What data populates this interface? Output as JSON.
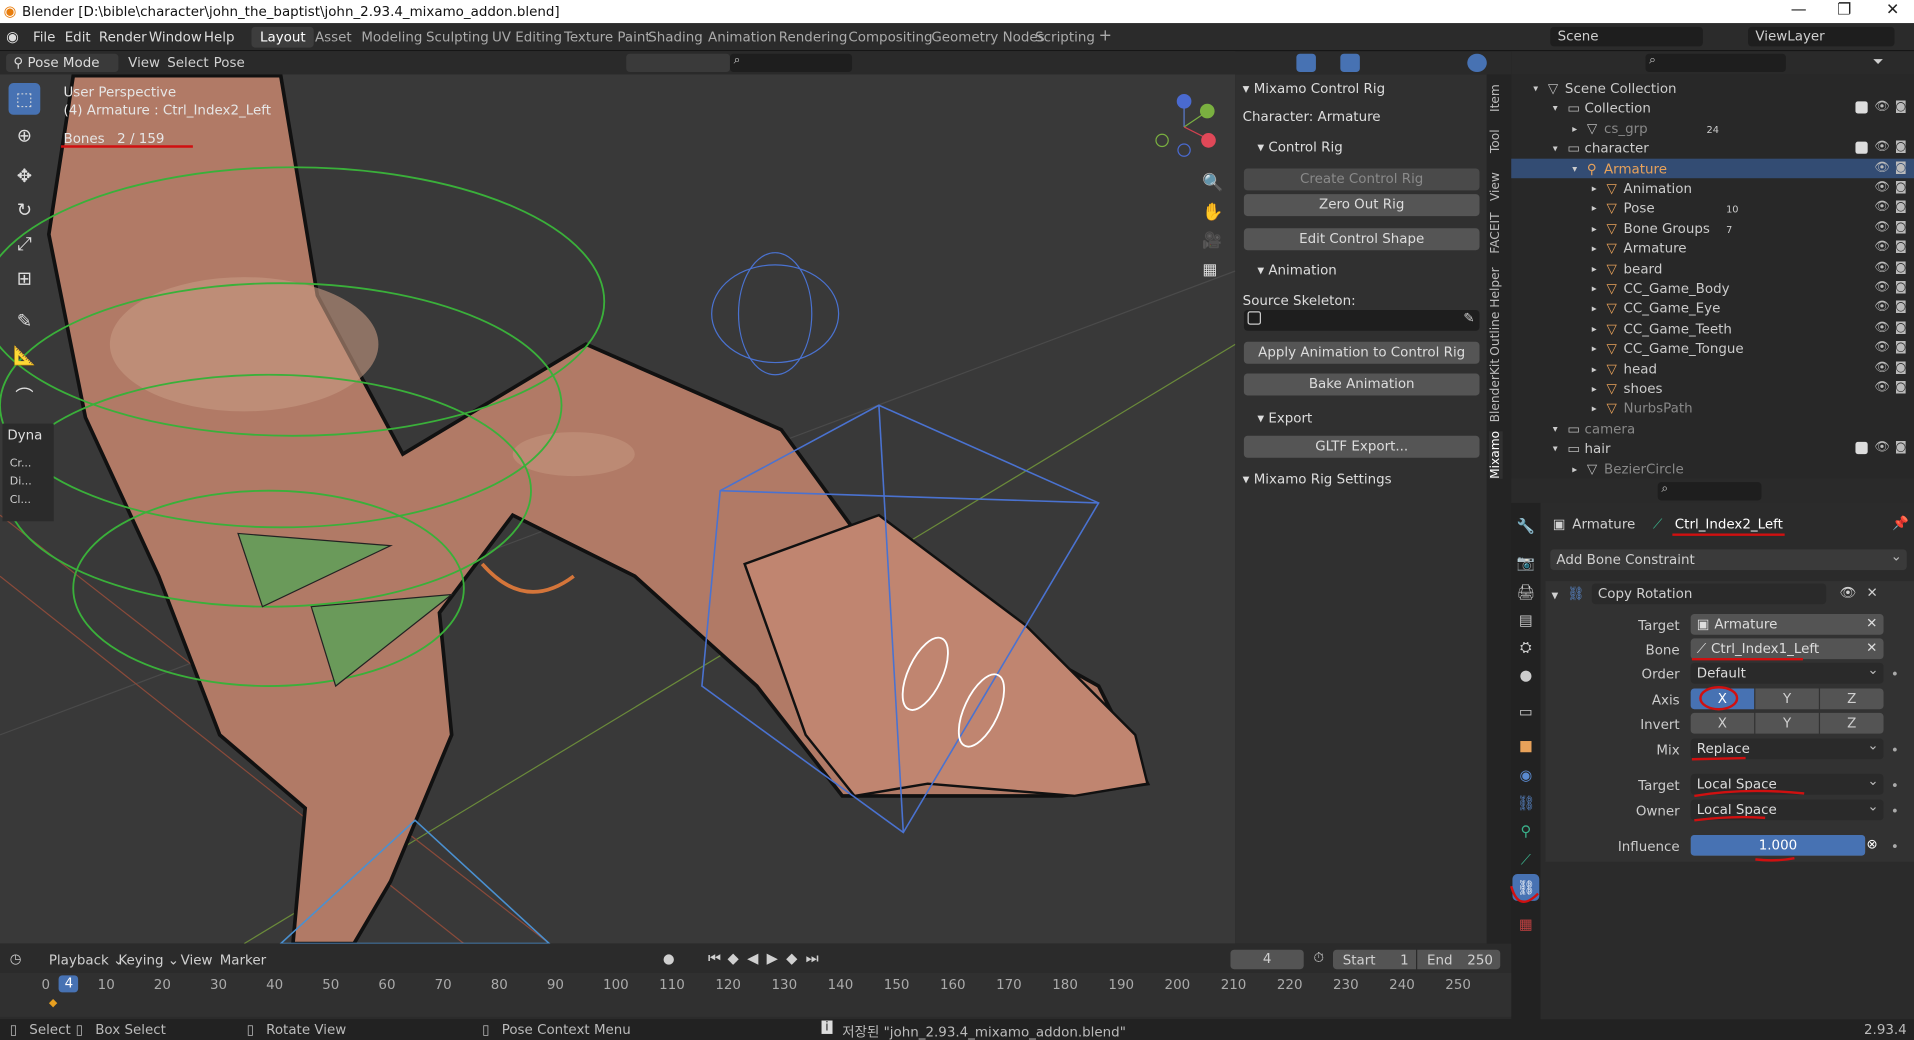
{
  "window": {
    "title": "Blender [D:\\bible\\character\\john_the_baptist\\john_2.93.4_mixamo_addon.blend]",
    "minimize": "—",
    "maximize": "❐",
    "close": "✕"
  },
  "menu": [
    "File",
    "Edit",
    "Render",
    "Window",
    "Help"
  ],
  "workspaces": [
    "Layout",
    "Asset",
    "Modeling",
    "Sculpting",
    "UV Editing",
    "Texture Paint",
    "Shading",
    "Animation",
    "Rendering",
    "Compositing",
    "Geometry Nodes",
    "Scripting"
  ],
  "scene": {
    "label": "Scene",
    "viewlayer": "ViewLayer"
  },
  "viewport_header": {
    "mode": "Pose Mode",
    "view": "View",
    "select": "Select",
    "pose": "Pose"
  },
  "viewport": {
    "perspective": "User Perspective",
    "object": "(4) Armature : Ctrl_Index2_Left",
    "bones_label": "Bones",
    "bones_count": "2 / 159",
    "dyna_label": "Dyna",
    "dyna_items": [
      "Cr...",
      "Di...",
      "Cl..."
    ]
  },
  "npanel": {
    "title": "Mixamo Control Rig",
    "character": "Character: Armature",
    "control_rig": "Control Rig",
    "create_btn": "Create Control Rig",
    "zero_btn": "Zero Out Rig",
    "edit_btn": "Edit Control Shape",
    "animation": "Animation",
    "source_label": "Source Skeleton:",
    "apply_btn": "Apply Animation to Control Rig",
    "bake_btn": "Bake Animation",
    "export": "Export",
    "gltf_btn": "GLTF Export...",
    "settings": "Mixamo Rig Settings",
    "tabs": [
      "Item",
      "Tool",
      "View",
      "FACEIT",
      "Outline Helper",
      "BlenderKit",
      "Mixamo"
    ]
  },
  "outliner": {
    "rows": [
      {
        "label": "Scene Collection",
        "indent": 0
      },
      {
        "label": "Collection",
        "indent": 1,
        "chk": true
      },
      {
        "label": "cs_grp",
        "indent": 2,
        "dim": true,
        "badge": "24"
      },
      {
        "label": "character",
        "indent": 1,
        "chk": true
      },
      {
        "label": "Armature",
        "indent": 2,
        "sel": true,
        "orange": true
      },
      {
        "label": "Animation",
        "indent": 3
      },
      {
        "label": "Pose",
        "indent": 3,
        "badge": "10"
      },
      {
        "label": "Bone Groups",
        "indent": 3,
        "badge": "7"
      },
      {
        "label": "Armature",
        "indent": 3
      },
      {
        "label": "beard",
        "indent": 3
      },
      {
        "label": "CC_Game_Body",
        "indent": 3
      },
      {
        "label": "CC_Game_Eye",
        "indent": 3
      },
      {
        "label": "CC_Game_Teeth",
        "indent": 3
      },
      {
        "label": "CC_Game_Tongue",
        "indent": 3
      },
      {
        "label": "head",
        "indent": 3
      },
      {
        "label": "shoes",
        "indent": 3
      },
      {
        "label": "NurbsPath",
        "indent": 3,
        "dim": true
      },
      {
        "label": "camera",
        "indent": 1,
        "dim": true
      },
      {
        "label": "hair",
        "indent": 1,
        "chk": true
      },
      {
        "label": "BezierCircle",
        "indent": 2,
        "dim": true
      }
    ]
  },
  "properties": {
    "armature": "Armature",
    "bone": "Ctrl_Index2_Left",
    "add_constraint": "Add Bone Constraint",
    "constraint_name": "Copy Rotation",
    "target_label": "Target",
    "target_value": "Armature",
    "bone_label": "Bone",
    "bone_value": "Ctrl_Index1_Left",
    "order_label": "Order",
    "order_value": "Default",
    "axis_label": "Axis",
    "invert_label": "Invert",
    "axes": [
      "X",
      "Y",
      "Z"
    ],
    "mix_label": "Mix",
    "mix_value": "Replace",
    "target_space_label": "Target",
    "target_space_value": "Local Space",
    "owner_label": "Owner",
    "owner_value": "Local Space",
    "influence_label": "Influence",
    "influence_value": "1.000",
    "influence_fraction": 1.0
  },
  "timeline": {
    "playback": "Playback",
    "keying": "Keying",
    "view": "View",
    "marker": "Marker",
    "current_frame": "4",
    "start_label": "Start",
    "start": "1",
    "end_label": "End",
    "end": "250",
    "ticks": [
      "0",
      "10",
      "20",
      "30",
      "40",
      "50",
      "60",
      "70",
      "80",
      "90",
      "100",
      "110",
      "120",
      "130",
      "140",
      "150",
      "160",
      "170",
      "180",
      "190",
      "200",
      "210",
      "220",
      "230",
      "240",
      "250"
    ],
    "playhead": "4"
  },
  "statusbar": {
    "select": "Select",
    "box_select": "Box Select",
    "rotate_view": "Rotate View",
    "pose_menu": "Pose Context Menu",
    "saved": "저장된 \"john_2.93.4_mixamo_addon.blend\"",
    "version": "2.93.4"
  },
  "colors": {
    "accent": "#4772b3",
    "selected_row": "#334c73",
    "annotation_red": "#d01010",
    "armature_orange": "#e8a25a"
  }
}
